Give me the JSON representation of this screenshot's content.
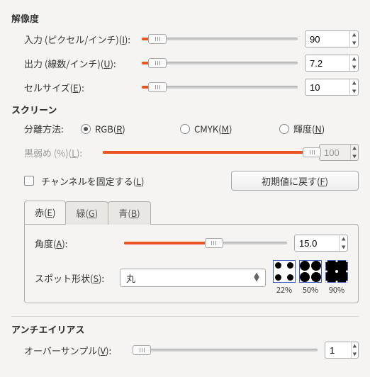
{
  "resolution": {
    "title": "解像度",
    "input_label_pre": "入力 (ピクセル/インチ)(",
    "input_key": "I",
    "input_label_post": "):",
    "input_value": "90",
    "input_slider_pct": 10,
    "output_label_pre": "出力 (線数/インチ)(",
    "output_key": "U",
    "output_label_post": "):",
    "output_value": "7.2",
    "output_slider_pct": 10,
    "cell_label_pre": "セルサイズ(",
    "cell_key": "E",
    "cell_label_post": "):",
    "cell_value": "10",
    "cell_slider_pct": 10
  },
  "screen": {
    "title": "スクリーン",
    "method_label": "分離方法:",
    "options": {
      "rgb_pre": "RGB(",
      "rgb_key": "R",
      "rgb_post": ")",
      "cmyk_pre": "CMYK(",
      "cmyk_key": "M",
      "cmyk_post": ")",
      "lum_pre": "輝度(",
      "lum_key": "N",
      "lum_post": ")"
    },
    "black_label_pre": "黒弱め (%)(",
    "black_key": "L",
    "black_label_post": "):",
    "black_value": "100",
    "lock_label_pre": "チャンネルを固定する(",
    "lock_key": "L",
    "lock_label_post": ")",
    "reset_label_pre": "初期値に戻す(",
    "reset_key": "F",
    "reset_label_post": ")"
  },
  "tabs": {
    "red_pre": "赤(",
    "red_key": "E",
    "red_post": ")",
    "green_pre": "緑(",
    "green_key": "G",
    "green_post": ")",
    "blue_pre": "青(",
    "blue_key": "B",
    "blue_post": ")"
  },
  "channel": {
    "angle_label_pre": "角度(",
    "angle_key": "A",
    "angle_label_post": "):",
    "angle_value": "15.0",
    "angle_slider_pct": 55,
    "spot_label_pre": "スポット形状(",
    "spot_key": "S",
    "spot_label_post": "):",
    "spot_value": "丸",
    "preview_22": "22%",
    "preview_50": "50%",
    "preview_90": "90%"
  },
  "antialias": {
    "title": "アンチエイリアス",
    "oversample_label_pre": "オーバーサンプル(",
    "oversample_key": "V",
    "oversample_label_post": "):",
    "oversample_value": "1",
    "oversample_slider_pct": 0
  }
}
